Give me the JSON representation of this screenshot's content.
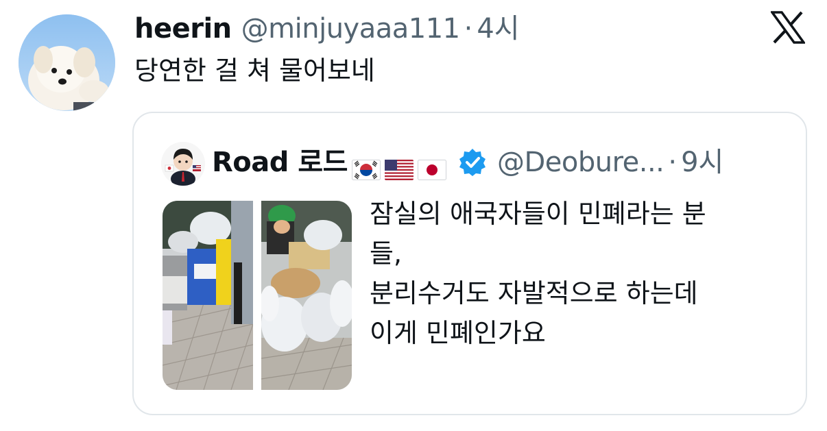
{
  "tweet": {
    "author_name": "heerin",
    "handle": "@minjuyaaa111",
    "separator": "·",
    "time": "4시",
    "text": "당연한 걸 쳐 물어보네"
  },
  "brand": {
    "icon": "x-logo-icon"
  },
  "quote": {
    "author_name": "Road 로드",
    "flags": [
      "kr-flag-icon",
      "us-flag-icon",
      "jp-flag-icon"
    ],
    "verified_icon": "verified-badge-icon",
    "handle": "@Deobure...",
    "separator": "·",
    "time": "9시",
    "text_lines": [
      "잠실의 애국자들이 민폐라는 분",
      "들,",
      "분리수거도 자발적으로 하는데",
      "이게 민폐인가요"
    ]
  },
  "colors": {
    "text_primary": "#0f1419",
    "text_secondary": "#536471",
    "verified": "#1d9bf0",
    "card_border": "#e1e6ea"
  }
}
